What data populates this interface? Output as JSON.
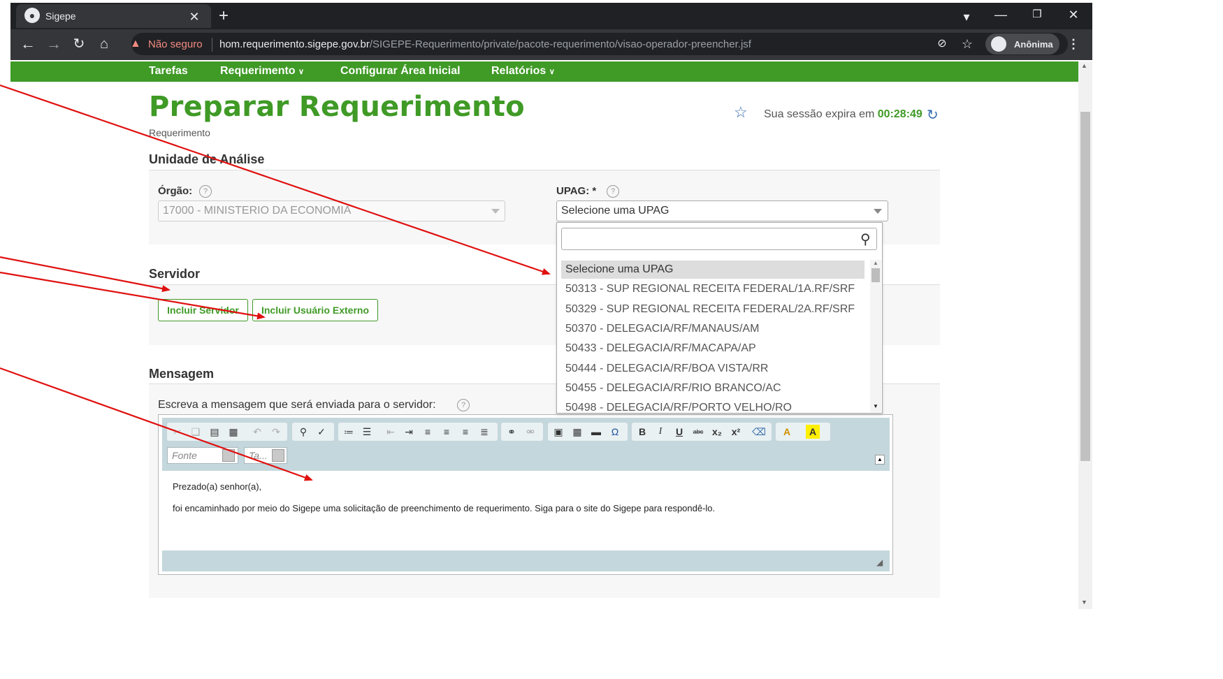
{
  "browser": {
    "tab_title": "Sigepe",
    "new_tab": "+",
    "security_warning": "Não seguro",
    "url_host": "hom.requerimento.sigepe.gov.br",
    "url_path": "/SIGEPE-Requerimento/private/pacote-requerimento/visao-operador-preencher.jsf",
    "profile": "Anônima"
  },
  "menu": {
    "items": [
      "Tarefas",
      "Requerimento",
      "Configurar Área Inicial",
      "Relatórios"
    ]
  },
  "page": {
    "title": "Preparar Requerimento",
    "breadcrumb": "Requerimento",
    "session_label": "Sua sessão expira em",
    "session_time": "00:28:49"
  },
  "unidade": {
    "section_title": "Unidade de Análise",
    "orgao_label": "Órgão:",
    "orgao_value": "17000 - MINISTERIO DA ECONOMIA",
    "upag_label": "UPAG:",
    "upag_required": "*",
    "upag_value": "Selecione uma UPAG"
  },
  "dropdown": {
    "options": [
      "Selecione uma UPAG",
      "50313 - SUP REGIONAL RECEITA FEDERAL/1A.RF/SRF",
      "50329 - SUP REGIONAL RECEITA FEDERAL/2A.RF/SRF",
      "50370 - DELEGACIA/RF/MANAUS/AM",
      "50433 - DELEGACIA/RF/MACAPA/AP",
      "50444 - DELEGACIA/RF/BOA VISTA/RR",
      "50455 - DELEGACIA/RF/RIO BRANCO/AC",
      "50498 - DELEGACIA/RF/PORTO VELHO/RO"
    ]
  },
  "servidor": {
    "section_title": "Servidor",
    "btn_incluir_servidor": "Incluir Servidor",
    "btn_incluir_externo": "Incluir Usuário Externo"
  },
  "mensagem": {
    "section_title": "Mensagem",
    "label": "Escreva a mensagem que será enviada para o servidor:",
    "font_combo": "Fonte",
    "size_combo": "Ta...",
    "line1": "Prezado(a) senhor(a),",
    "line2": "foi encaminhado por meio do Sigepe uma solicitação de preenchimento de requerimento. Siga para o site do Sigepe para respondê-lo."
  },
  "colors": {
    "brand_green": "#3f9a26",
    "annotation_red": "#e01010",
    "warning": "#f28b82"
  }
}
